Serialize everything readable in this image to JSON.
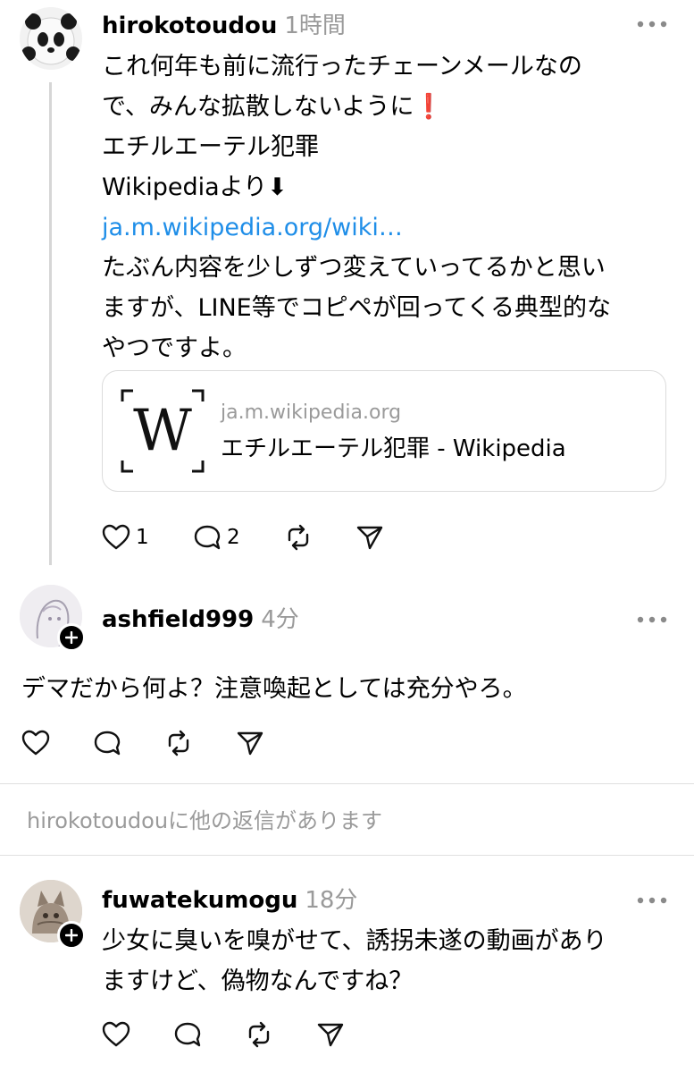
{
  "post": {
    "username": "hirokotoudou",
    "timestamp": "1時間",
    "lines": [
      "これ何年も前に流行ったチェーンメールなの",
      "で、みんな拡散しないように❗",
      "エチルエーテル犯罪",
      "Wikipediaより⬇"
    ],
    "link": "ja.m.wikipedia.org/wiki…",
    "lines_after": [
      "たぶん内容を少しずつ変えていってるかと思い",
      "ますが、LINE等でコピペが回ってくる典型的な",
      "やつですよ。"
    ],
    "card": {
      "logo": "W",
      "domain": "ja.m.wikipedia.org",
      "title": "エチルエーテル犯罪 - Wikipedia"
    },
    "like_count": "1",
    "reply_count": "2"
  },
  "reply1": {
    "username": "ashfield999",
    "timestamp": "4分",
    "text": "デマだから何よ？注意喚起としては充分やろ。"
  },
  "more_replies": "hirokotoudouに他の返信があります",
  "reply2": {
    "username": "fuwatekumogu",
    "timestamp": "18分",
    "lines": [
      "少女に臭いを嗅がせて、誘拐未遂の動画があり",
      "ますけど、偽物なんですね？"
    ]
  },
  "icons": {
    "like": "heart-icon",
    "reply": "comment-icon",
    "repost": "repost-icon",
    "share": "send-icon",
    "more": "more-icon",
    "follow": "plus-icon"
  },
  "colors": {
    "link": "#1f8ee8",
    "muted": "#9a9a9a",
    "divider": "#e0e0e0",
    "thread_line": "#d6d6d6"
  }
}
